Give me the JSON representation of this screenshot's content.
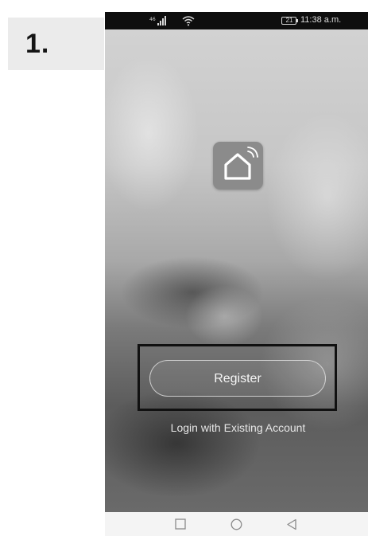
{
  "step": {
    "label": "1."
  },
  "status_bar": {
    "signal_glyph": "⁴⁶",
    "battery_level": "21",
    "time": "11:38 a.m.",
    "icons": [
      "signal-icon",
      "wifi-icon",
      "battery-icon"
    ]
  },
  "app": {
    "logo_icon": "smart-home-icon",
    "register_label": "Register",
    "login_label": "Login with Existing Account"
  },
  "nav_bar": {
    "icons": [
      "square-recent-icon",
      "circle-home-icon",
      "triangle-back-icon"
    ]
  },
  "colors": {
    "highlight": "#111111",
    "logo_tile": "#8b8b8b",
    "step_box": "#ebebeb"
  }
}
